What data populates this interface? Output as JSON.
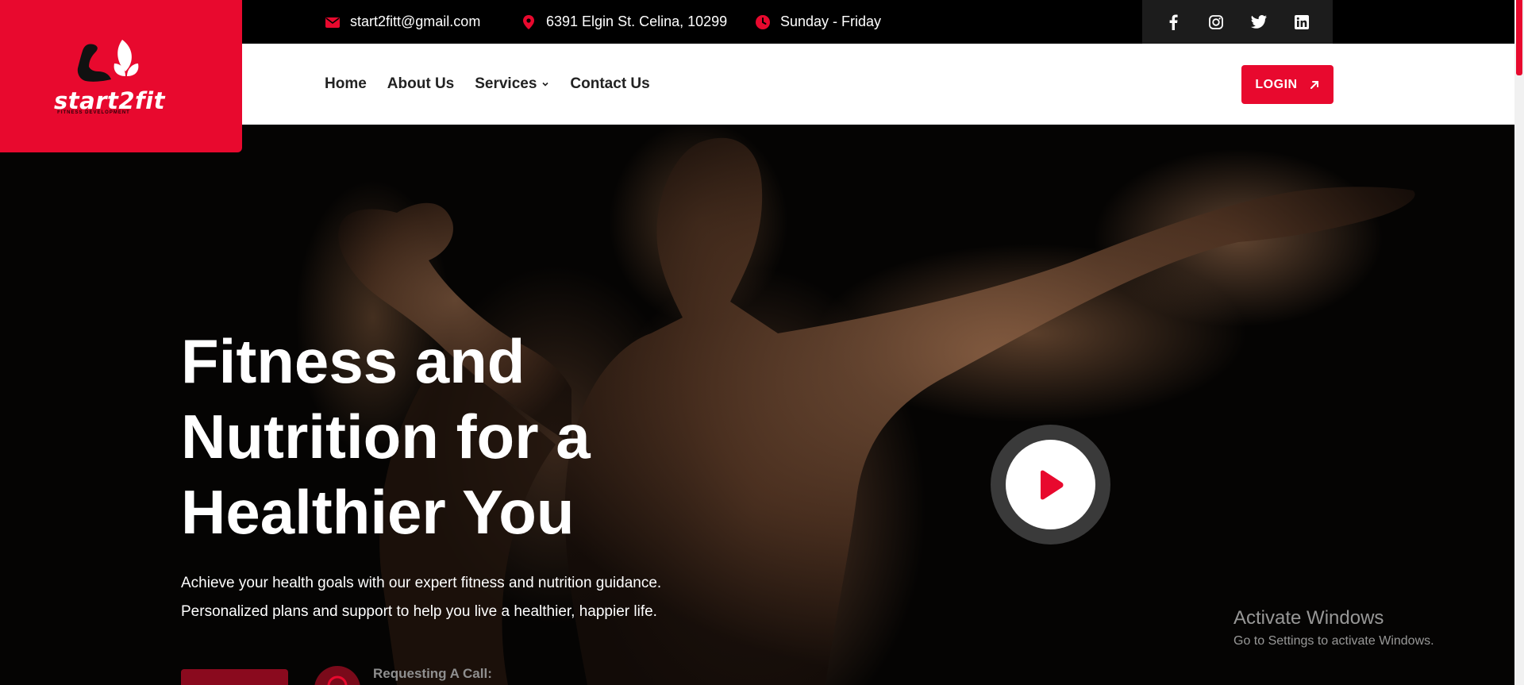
{
  "brand": {
    "name": "start2fit",
    "tagline": "FITNESS DEVELOPMENT",
    "accent_color": "#e8092e"
  },
  "topbar": {
    "email": "start2fitt@gmail.com",
    "address": "6391 Elgin St. Celina, 10299",
    "hours": "Sunday - Friday",
    "email_icon": "envelope-icon",
    "address_icon": "map-pin-icon",
    "hours_icon": "clock-icon",
    "socials": [
      "facebook-icon",
      "instagram-icon",
      "twitter-icon",
      "linkedin-icon"
    ]
  },
  "nav": {
    "items": [
      {
        "label": "Home"
      },
      {
        "label": "About Us"
      },
      {
        "label": "Services"
      },
      {
        "label": "Contact Us"
      }
    ],
    "login_label": "LOGIN"
  },
  "hero": {
    "headline_lines": [
      "Fitness and",
      "Nutrition for a",
      "Healthier You"
    ],
    "subtext_lines": [
      "Achieve your health goals with our expert fitness and nutrition guidance.",
      "Personalized plans and support to help you live a healthier, happier life."
    ],
    "call_label": "Requesting A Call:"
  },
  "watermark": {
    "title": "Activate Windows",
    "subtitle": "Go to Settings to activate Windows."
  }
}
